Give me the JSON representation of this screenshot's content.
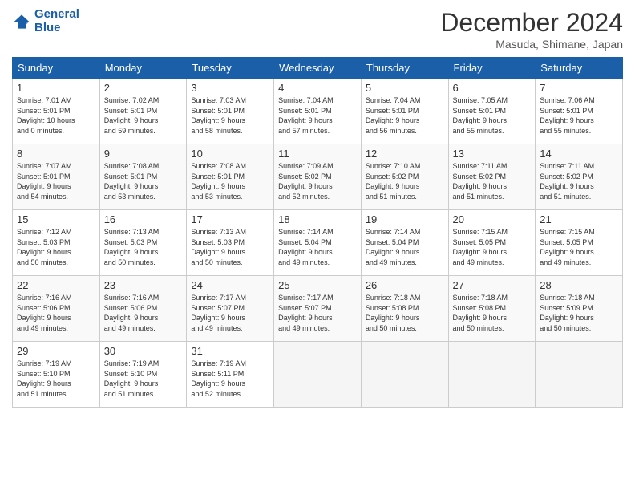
{
  "header": {
    "logo_line1": "General",
    "logo_line2": "Blue",
    "month": "December 2024",
    "location": "Masuda, Shimane, Japan"
  },
  "weekdays": [
    "Sunday",
    "Monday",
    "Tuesday",
    "Wednesday",
    "Thursday",
    "Friday",
    "Saturday"
  ],
  "weeks": [
    [
      {
        "day": "1",
        "info": "Sunrise: 7:01 AM\nSunset: 5:01 PM\nDaylight: 10 hours\nand 0 minutes."
      },
      {
        "day": "2",
        "info": "Sunrise: 7:02 AM\nSunset: 5:01 PM\nDaylight: 9 hours\nand 59 minutes."
      },
      {
        "day": "3",
        "info": "Sunrise: 7:03 AM\nSunset: 5:01 PM\nDaylight: 9 hours\nand 58 minutes."
      },
      {
        "day": "4",
        "info": "Sunrise: 7:04 AM\nSunset: 5:01 PM\nDaylight: 9 hours\nand 57 minutes."
      },
      {
        "day": "5",
        "info": "Sunrise: 7:04 AM\nSunset: 5:01 PM\nDaylight: 9 hours\nand 56 minutes."
      },
      {
        "day": "6",
        "info": "Sunrise: 7:05 AM\nSunset: 5:01 PM\nDaylight: 9 hours\nand 55 minutes."
      },
      {
        "day": "7",
        "info": "Sunrise: 7:06 AM\nSunset: 5:01 PM\nDaylight: 9 hours\nand 55 minutes."
      }
    ],
    [
      {
        "day": "8",
        "info": "Sunrise: 7:07 AM\nSunset: 5:01 PM\nDaylight: 9 hours\nand 54 minutes."
      },
      {
        "day": "9",
        "info": "Sunrise: 7:08 AM\nSunset: 5:01 PM\nDaylight: 9 hours\nand 53 minutes."
      },
      {
        "day": "10",
        "info": "Sunrise: 7:08 AM\nSunset: 5:01 PM\nDaylight: 9 hours\nand 53 minutes."
      },
      {
        "day": "11",
        "info": "Sunrise: 7:09 AM\nSunset: 5:02 PM\nDaylight: 9 hours\nand 52 minutes."
      },
      {
        "day": "12",
        "info": "Sunrise: 7:10 AM\nSunset: 5:02 PM\nDaylight: 9 hours\nand 51 minutes."
      },
      {
        "day": "13",
        "info": "Sunrise: 7:11 AM\nSunset: 5:02 PM\nDaylight: 9 hours\nand 51 minutes."
      },
      {
        "day": "14",
        "info": "Sunrise: 7:11 AM\nSunset: 5:02 PM\nDaylight: 9 hours\nand 51 minutes."
      }
    ],
    [
      {
        "day": "15",
        "info": "Sunrise: 7:12 AM\nSunset: 5:03 PM\nDaylight: 9 hours\nand 50 minutes."
      },
      {
        "day": "16",
        "info": "Sunrise: 7:13 AM\nSunset: 5:03 PM\nDaylight: 9 hours\nand 50 minutes."
      },
      {
        "day": "17",
        "info": "Sunrise: 7:13 AM\nSunset: 5:03 PM\nDaylight: 9 hours\nand 50 minutes."
      },
      {
        "day": "18",
        "info": "Sunrise: 7:14 AM\nSunset: 5:04 PM\nDaylight: 9 hours\nand 49 minutes."
      },
      {
        "day": "19",
        "info": "Sunrise: 7:14 AM\nSunset: 5:04 PM\nDaylight: 9 hours\nand 49 minutes."
      },
      {
        "day": "20",
        "info": "Sunrise: 7:15 AM\nSunset: 5:05 PM\nDaylight: 9 hours\nand 49 minutes."
      },
      {
        "day": "21",
        "info": "Sunrise: 7:15 AM\nSunset: 5:05 PM\nDaylight: 9 hours\nand 49 minutes."
      }
    ],
    [
      {
        "day": "22",
        "info": "Sunrise: 7:16 AM\nSunset: 5:06 PM\nDaylight: 9 hours\nand 49 minutes."
      },
      {
        "day": "23",
        "info": "Sunrise: 7:16 AM\nSunset: 5:06 PM\nDaylight: 9 hours\nand 49 minutes."
      },
      {
        "day": "24",
        "info": "Sunrise: 7:17 AM\nSunset: 5:07 PM\nDaylight: 9 hours\nand 49 minutes."
      },
      {
        "day": "25",
        "info": "Sunrise: 7:17 AM\nSunset: 5:07 PM\nDaylight: 9 hours\nand 49 minutes."
      },
      {
        "day": "26",
        "info": "Sunrise: 7:18 AM\nSunset: 5:08 PM\nDaylight: 9 hours\nand 50 minutes."
      },
      {
        "day": "27",
        "info": "Sunrise: 7:18 AM\nSunset: 5:08 PM\nDaylight: 9 hours\nand 50 minutes."
      },
      {
        "day": "28",
        "info": "Sunrise: 7:18 AM\nSunset: 5:09 PM\nDaylight: 9 hours\nand 50 minutes."
      }
    ],
    [
      {
        "day": "29",
        "info": "Sunrise: 7:19 AM\nSunset: 5:10 PM\nDaylight: 9 hours\nand 51 minutes."
      },
      {
        "day": "30",
        "info": "Sunrise: 7:19 AM\nSunset: 5:10 PM\nDaylight: 9 hours\nand 51 minutes."
      },
      {
        "day": "31",
        "info": "Sunrise: 7:19 AM\nSunset: 5:11 PM\nDaylight: 9 hours\nand 52 minutes."
      },
      null,
      null,
      null,
      null
    ]
  ]
}
